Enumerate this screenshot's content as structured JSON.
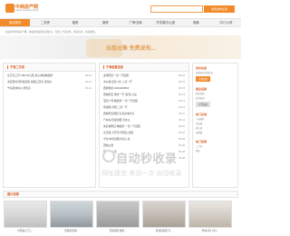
{
  "header": {
    "logo_text": "中商房产网",
    "logo_sub": "Anjuke Fangchan Wang",
    "search_placeholder": "",
    "search_button": "免费发布房源"
  },
  "nav": {
    "items": [
      {
        "label": "网站首页",
        "active": true
      },
      {
        "label": "二手房",
        "active": false
      },
      {
        "label": "租房",
        "active": false
      },
      {
        "label": "新房",
        "active": false
      },
      {
        "label": "厂房/仓库",
        "active": false
      },
      {
        "label": "写字楼/办公室",
        "active": false
      },
      {
        "label": "商铺",
        "active": false
      },
      {
        "label": "中介/公司",
        "active": false
      }
    ]
  },
  "location_bar": "欢迎访问中商房产网，本站提供最新房源信息，包括二手房出售、租房信息、新房楼盘。",
  "banner": {
    "text": "出租出售  免费发布..."
  },
  "left_panel": {
    "title": "宁海二手房",
    "rows": [
      {
        "title": "北京东三环 CBD 中心区 核心地段精装修",
        "date": "08-15"
      },
      {
        "title": "海淀西北旺科技园旁 板楼三居室 采光好",
        "date": "09-21"
      },
      {
        "title": "宁海县城中心 学区房",
        "date": "05-14"
      }
    ]
  },
  "mid_panel": {
    "title": "宁海租售信息",
    "rows": [
      {
        "title": "秦港附近一室一厅出租",
        "date": "08-26"
      },
      {
        "title": "中兴城 出售 3房 二室一厅",
        "date": "08-15"
      },
      {
        "title": "西城繁星13919909862",
        "date": "08-15"
      },
      {
        "title": "西城附近 两室一厅 (拎包入住)",
        "date": "05-13"
      },
      {
        "title": "宝龙广场 精装修 一室一厅出租",
        "date": "05-12"
      },
      {
        "title": "南湖路 月租 二室一厅",
        "date": "05-12"
      },
      {
        "title": "西城附近两居 家具家电齐全",
        "date": "05-11"
      },
      {
        "title": "汽车站 旺铺出租 可办公",
        "date": "05-11"
      },
      {
        "title": "客商城附近 精装修 一室一厅出租",
        "date": "05-10"
      },
      {
        "title": "北京路 大开间 带阳台 出租",
        "date": "05-10"
      },
      {
        "title": "宁海 单间出租 拎包入住",
        "date": "05-09"
      },
      {
        "title": "西城公寓",
        "date": "05-09"
      },
      {
        "title": "开发路 二室",
        "date": "05-08"
      },
      {
        "title": "宁海 出售",
        "date": "05-08"
      }
    ]
  },
  "right_panel": {
    "sections": [
      {
        "title": "发布信息",
        "lines": [
          "免费发布房源信息"
        ],
        "buttons": [
          "免费发布"
        ]
      },
      {
        "title": "置业指南",
        "lines": [
          "购房须知",
          "贷款指南"
        ],
        "buttons": [
          "户型展示"
        ]
      },
      {
        "title": "热门区域",
        "lines": [
          "宁海城区",
          "西店镇",
          "桥头胡",
          "深甽镇"
        ],
        "buttons": []
      },
      {
        "title": "热门房源",
        "lines": [
          "二手房",
          "租房"
        ],
        "buttons": []
      }
    ]
  },
  "photos": {
    "title": "图片房源",
    "items": [
      {
        "caption": "中西路五号三..."
      },
      {
        "caption": "西城嘉园 精..."
      },
      {
        "caption": "西城嘉园 精装..."
      },
      {
        "caption": "晋城新丽都 仓..."
      },
      {
        "caption": "坦城小区 1室1..."
      }
    ]
  },
  "watermark": {
    "main": "自动秒收录",
    "sub": "网址提交·来访一次·自动收录"
  },
  "colors": {
    "accent": "#f08a2a",
    "heading": "#d9622b"
  }
}
